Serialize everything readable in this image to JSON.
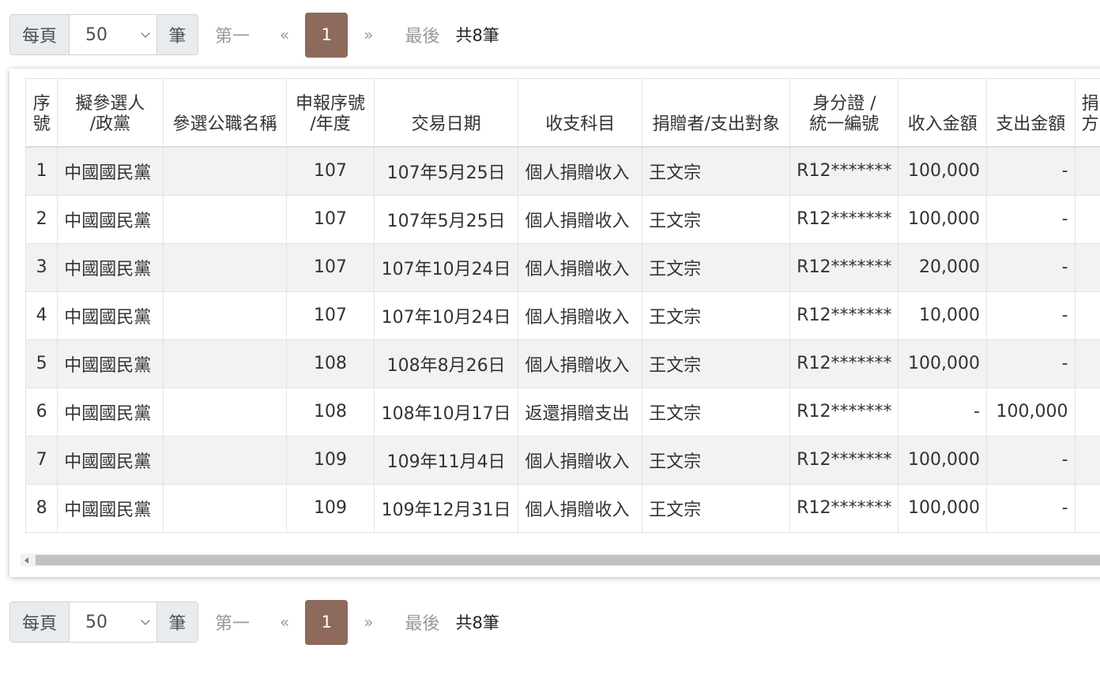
{
  "pager": {
    "per_page_prefix": "每頁",
    "per_page_value": "50",
    "per_page_suffix": "筆",
    "first": "第一",
    "prev": "«",
    "current_page": "1",
    "next": "»",
    "last": "最後",
    "total": "共8筆"
  },
  "table": {
    "headers": [
      {
        "line1": "序",
        "line2": "號"
      },
      {
        "line1": "擬參選人",
        "line2": "/政黨"
      },
      {
        "line1": "",
        "line2": "參選公職名稱"
      },
      {
        "line1": "申報序號",
        "line2": "/年度"
      },
      {
        "line1": "",
        "line2": "交易日期"
      },
      {
        "line1": "",
        "line2": "收支科目"
      },
      {
        "line1": "",
        "line2": "捐贈者/支出對象"
      },
      {
        "line1": "身分證 /",
        "line2": "統一編號"
      },
      {
        "line1": "",
        "line2": "收入金額"
      },
      {
        "line1": "",
        "line2": "支出金額"
      },
      {
        "line1": "捐",
        "line2": "方"
      }
    ],
    "rows": [
      {
        "no": "1",
        "party": "中國國民黨",
        "office": "",
        "year": "107",
        "date": "107年5月25日",
        "subject": "個人捐贈收入",
        "donor": "王文宗",
        "id": "R12*******",
        "income": "100,000",
        "expense": "-"
      },
      {
        "no": "2",
        "party": "中國國民黨",
        "office": "",
        "year": "107",
        "date": "107年5月25日",
        "subject": "個人捐贈收入",
        "donor": "王文宗",
        "id": "R12*******",
        "income": "100,000",
        "expense": "-"
      },
      {
        "no": "3",
        "party": "中國國民黨",
        "office": "",
        "year": "107",
        "date": "107年10月24日",
        "subject": "個人捐贈收入",
        "donor": "王文宗",
        "id": "R12*******",
        "income": "20,000",
        "expense": "-"
      },
      {
        "no": "4",
        "party": "中國國民黨",
        "office": "",
        "year": "107",
        "date": "107年10月24日",
        "subject": "個人捐贈收入",
        "donor": "王文宗",
        "id": "R12*******",
        "income": "10,000",
        "expense": "-"
      },
      {
        "no": "5",
        "party": "中國國民黨",
        "office": "",
        "year": "108",
        "date": "108年8月26日",
        "subject": "個人捐贈收入",
        "donor": "王文宗",
        "id": "R12*******",
        "income": "100,000",
        "expense": "-"
      },
      {
        "no": "6",
        "party": "中國國民黨",
        "office": "",
        "year": "108",
        "date": "108年10月17日",
        "subject": "返還捐贈支出",
        "donor": "王文宗",
        "id": "R12*******",
        "income": "-",
        "expense": "100,000"
      },
      {
        "no": "7",
        "party": "中國國民黨",
        "office": "",
        "year": "109",
        "date": "109年11月4日",
        "subject": "個人捐贈收入",
        "donor": "王文宗",
        "id": "R12*******",
        "income": "100,000",
        "expense": "-"
      },
      {
        "no": "8",
        "party": "中國國民黨",
        "office": "",
        "year": "109",
        "date": "109年12月31日",
        "subject": "個人捐贈收入",
        "donor": "王文宗",
        "id": "R12*******",
        "income": "100,000",
        "expense": "-"
      }
    ]
  }
}
